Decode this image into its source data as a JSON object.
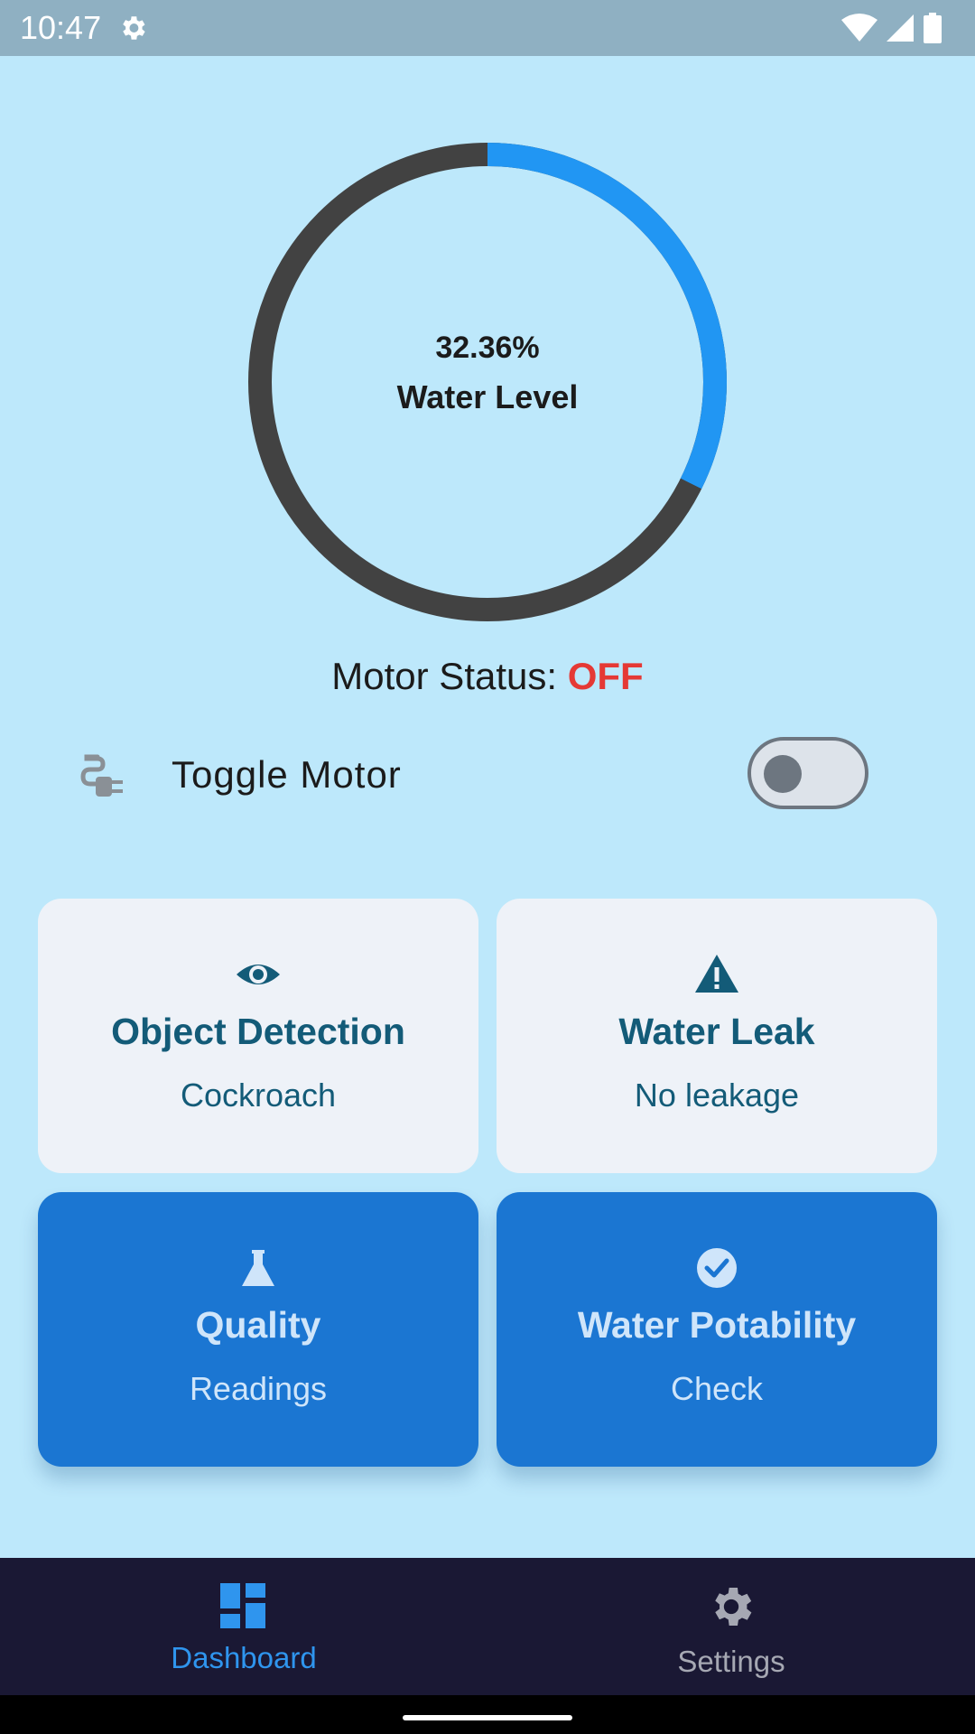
{
  "status_bar": {
    "time": "10:47"
  },
  "water_level": {
    "percent_text": "32.36%",
    "label": "Water Level",
    "fraction": 0.3236
  },
  "motor": {
    "status_label": "Motor Status: ",
    "status_value": "OFF",
    "toggle_label": "Toggle Motor",
    "toggle_on": false
  },
  "cards": [
    {
      "title": "Object Detection",
      "subtitle": "Cockroach",
      "icon": "eye-icon"
    },
    {
      "title": "Water Leak",
      "subtitle": "No leakage",
      "icon": "warning-icon"
    },
    {
      "title": "Quality",
      "subtitle": "Readings",
      "icon": "flask-icon"
    },
    {
      "title": "Water Potability",
      "subtitle": "Check",
      "icon": "check-circle-icon"
    }
  ],
  "nav": [
    {
      "label": "Dashboard",
      "icon": "dashboard-icon",
      "active": true
    },
    {
      "label": "Settings",
      "icon": "gear-icon",
      "active": false
    }
  ],
  "colors": {
    "background": "#bde8fb",
    "gauge_fill": "#2196f3",
    "gauge_track": "#424242",
    "status_off": "#e53935",
    "card_light": "#eef2f8",
    "card_blue": "#1b76d2",
    "nav_bg": "#1a1834",
    "nav_active": "#2f95ee"
  }
}
